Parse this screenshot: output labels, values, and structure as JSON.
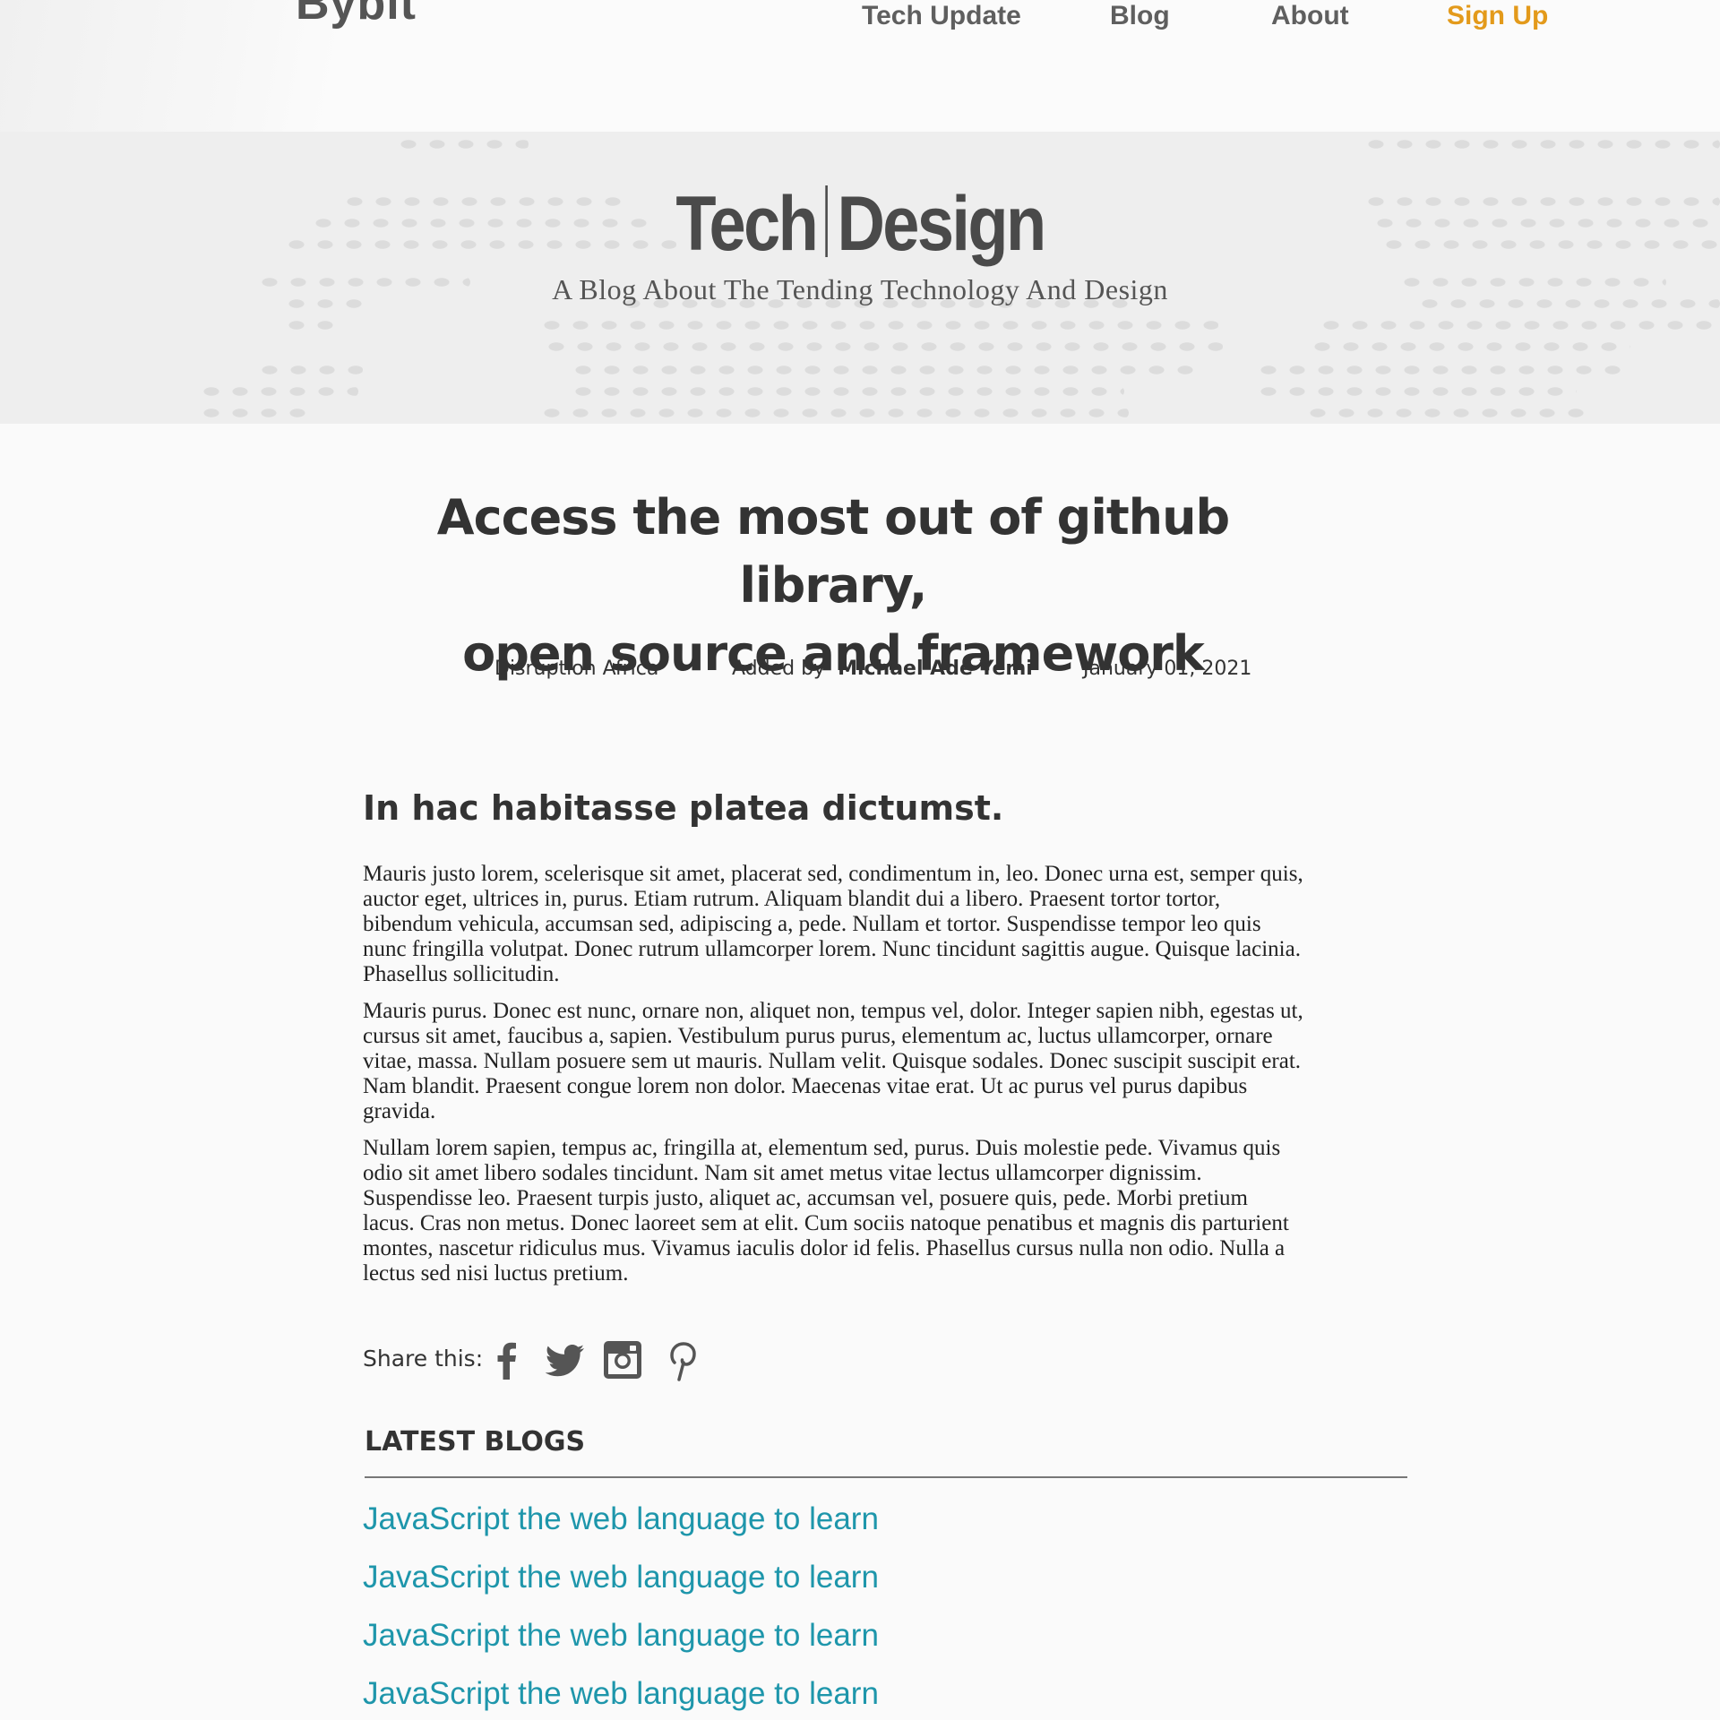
{
  "header": {
    "logo": "Bybit",
    "nav": {
      "tech_update": "Tech Update",
      "blog": "Blog",
      "about": "About",
      "sign_up": "Sign Up"
    }
  },
  "banner": {
    "brand_left": "Tech",
    "brand_right": "Design",
    "tagline": "A Blog About The Tending Technology And Design"
  },
  "article": {
    "title_line1": "Access the most out of github library,",
    "title_line2": "open source and framework",
    "meta": {
      "source": "Disruption Africa",
      "added_by_label": "Added by",
      "author": "Michael Ade Yemi",
      "date": "January 01, 2021"
    },
    "section_heading": "In hac habitasse platea dictumst.",
    "paragraphs": [
      "Mauris justo lorem, scelerisque sit amet, placerat sed, condimentum in, leo. Donec urna est, semper quis, auctor eget, ultrices in, purus. Etiam rutrum. Aliquam blandit dui a libero. Praesent tortor tortor, bibendum vehicula, accumsan sed, adipiscing a, pede. Nullam et tortor. Suspendisse tempor leo quis nunc fringilla volutpat. Donec rutrum ullamcorper lorem. Nunc tincidunt sagittis augue. Quisque lacinia. Phasellus sollicitudin.",
      "Mauris purus. Donec est nunc, ornare non, aliquet non, tempus vel, dolor. Integer sapien nibh, egestas ut, cursus sit amet, faucibus a, sapien. Vestibulum purus purus, elementum ac, luctus ullamcorper, ornare vitae, massa. Nullam posuere sem ut mauris. Nullam velit. Quisque sodales. Donec suscipit suscipit erat. Nam blandit. Praesent congue lorem non dolor. Maecenas vitae erat. Ut ac purus vel purus dapibus gravida.",
      "Nullam lorem sapien, tempus ac, fringilla at, elementum sed, purus. Duis molestie pede. Vivamus quis odio sit amet libero sodales tincidunt. Nam sit amet metus vitae lectus ullamcorper dignissim. Suspendisse leo. Praesent turpis justo, aliquet ac, accumsan vel, posuere quis, pede. Morbi pretium lacus. Cras non metus. Donec laoreet sem at elit. Cum sociis natoque penatibus et magnis dis parturient montes, nascetur ridiculus mus. Vivamus iaculis dolor id felis. Phasellus cursus nulla non odio. Nulla a lectus sed nisi luctus pretium."
    ]
  },
  "share": {
    "label": "Share this:",
    "icons": [
      "facebook-icon",
      "twitter-icon",
      "instagram-icon",
      "pinterest-icon"
    ]
  },
  "latest_blogs": {
    "heading": "LATEST BLOGS",
    "items": [
      "JavaScript the web language to learn",
      "JavaScript the web language to learn",
      "JavaScript the web language to learn",
      "JavaScript the web language to learn"
    ]
  },
  "colors": {
    "accent_orange": "#e39a1b",
    "link_teal": "#1e96ab",
    "text_dark": "#333333"
  }
}
